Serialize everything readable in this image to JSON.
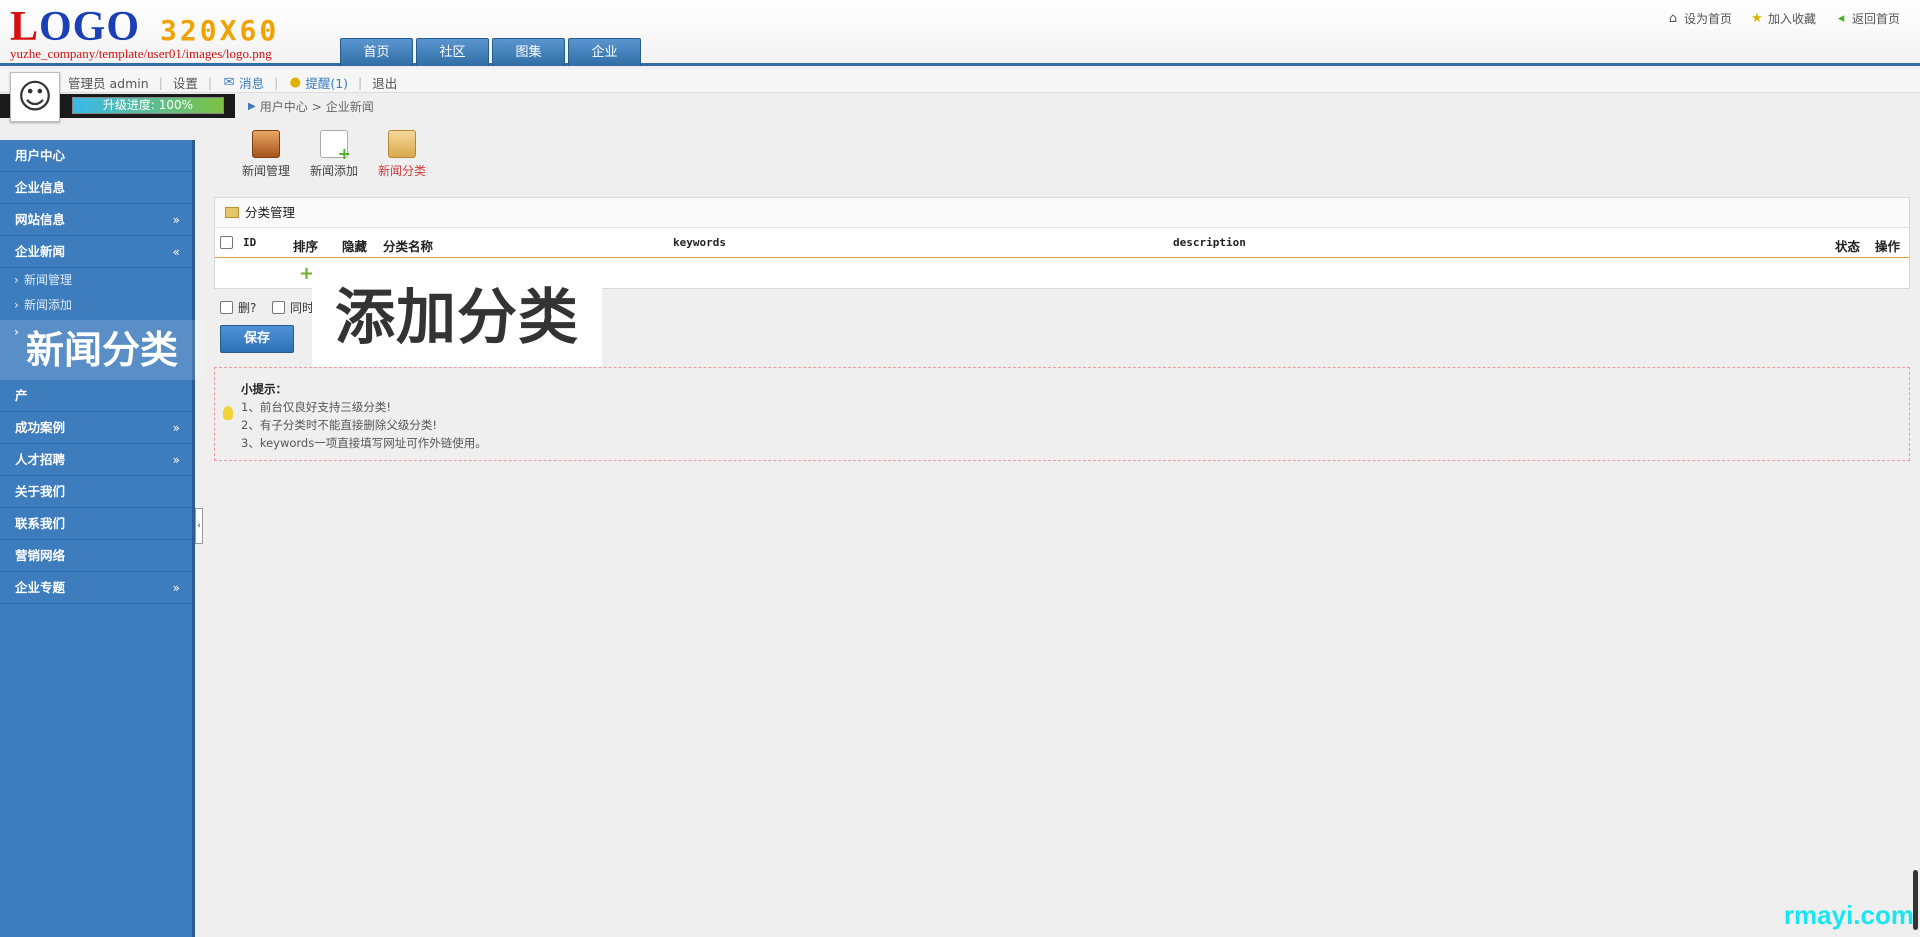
{
  "header": {
    "logo_text_red": "L",
    "logo_text_blue": "OGO",
    "logo_size": "320X60",
    "logo_path": "yuzhe_company/template/user01/images/logo.png",
    "nav_tabs": [
      "首页",
      "社区",
      "图集",
      "企业"
    ],
    "top_links": [
      {
        "icon": "home-icon",
        "label": "设为首页"
      },
      {
        "icon": "star-icon",
        "label": "加入收藏"
      },
      {
        "icon": "back-icon",
        "label": "返回首页"
      }
    ]
  },
  "userbar": {
    "user": "管理员 admin",
    "settings": "设置",
    "messages": "消息",
    "reminder": "提醒(1)",
    "logout": "退出",
    "progress_label": "升级进度: 100%",
    "progress_value": 100,
    "breadcrumb": [
      "用户中心",
      "企业新闻"
    ]
  },
  "sidebar": {
    "items": [
      {
        "label": "用户中心",
        "chevron": ""
      },
      {
        "label": "企业信息",
        "chevron": ""
      },
      {
        "label": "网站信息",
        "chevron": "»"
      },
      {
        "label": "企业新闻",
        "chevron": "«"
      }
    ],
    "sub_items": [
      "新闻管理",
      "新闻添加",
      "新闻分类"
    ],
    "items_after": [
      {
        "label": "产",
        "chevron": ""
      },
      {
        "label": "成功案例",
        "chevron": "»"
      },
      {
        "label": "人才招聘",
        "chevron": "»"
      },
      {
        "label": "关于我们",
        "chevron": ""
      },
      {
        "label": "联系我们",
        "chevron": ""
      },
      {
        "label": "营销网络",
        "chevron": ""
      },
      {
        "label": "企业专题",
        "chevron": "»"
      }
    ]
  },
  "quick_actions": [
    {
      "label": "新闻管理",
      "icon": "box-icon"
    },
    {
      "label": "新闻添加",
      "icon": "add-doc-icon"
    },
    {
      "label": "新闻分类",
      "icon": "folder-icon"
    }
  ],
  "panel": {
    "title": "分类管理",
    "columns": [
      "ID",
      "排序",
      "隐藏",
      "分类名称",
      "keywords",
      "description",
      "状态",
      "操作"
    ]
  },
  "controls": {
    "delete_label": "删?",
    "sync_label": "同时",
    "overlay_text": "添加分类",
    "save_button": "保存"
  },
  "tips": {
    "title": "小提示：",
    "lines": [
      "1、前台仅良好支持三级分类!",
      "2、有子分类时不能直接删除父级分类!",
      "3、keywords一项直接填写网址可作外链使用。"
    ]
  },
  "watermark": "rmayi.com",
  "colors": {
    "sidebar_bg": "#3d7cbd",
    "nav_tab": "#2f6ea5",
    "accent_red": "#d23a3a",
    "tip_border": "#f09aa0"
  }
}
